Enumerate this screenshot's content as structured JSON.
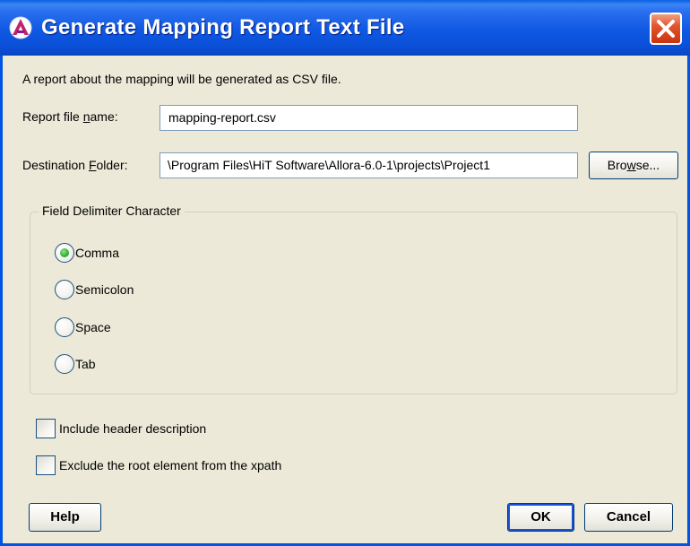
{
  "window": {
    "title": "Generate Mapping Report Text File"
  },
  "description": "A report about the mapping will be generated as CSV file.",
  "report_file": {
    "label_prefix": "Report file ",
    "label_mnemonic": "n",
    "label_suffix": "ame:",
    "value": "mapping-report.csv"
  },
  "destination": {
    "label_prefix": "Destination ",
    "label_mnemonic": "F",
    "label_suffix": "older:",
    "value": "\\Program Files\\HiT Software\\Allora-6.0-1\\projects\\Project1",
    "browse_prefix": "Bro",
    "browse_mnemonic": "w",
    "browse_suffix": "se..."
  },
  "delimiter": {
    "group_title": "Field Delimiter Character",
    "selected": "Comma",
    "options": [
      {
        "label": "Comma",
        "checked": true
      },
      {
        "label": "Semicolon",
        "checked": false
      },
      {
        "label": "Space",
        "checked": false
      },
      {
        "label": "Tab",
        "checked": false
      }
    ]
  },
  "options": [
    {
      "label": "Include header description",
      "checked": false
    },
    {
      "label": "Exclude the root element from the xpath",
      "checked": false
    }
  ],
  "buttons": {
    "help": "Help",
    "ok": "OK",
    "cancel": "Cancel"
  },
  "colors": {
    "titlebar": "#0a4fd6",
    "dialog_bg": "#ece9d8",
    "close_button": "#e2552e",
    "radio_selected": "#2fb22f"
  }
}
